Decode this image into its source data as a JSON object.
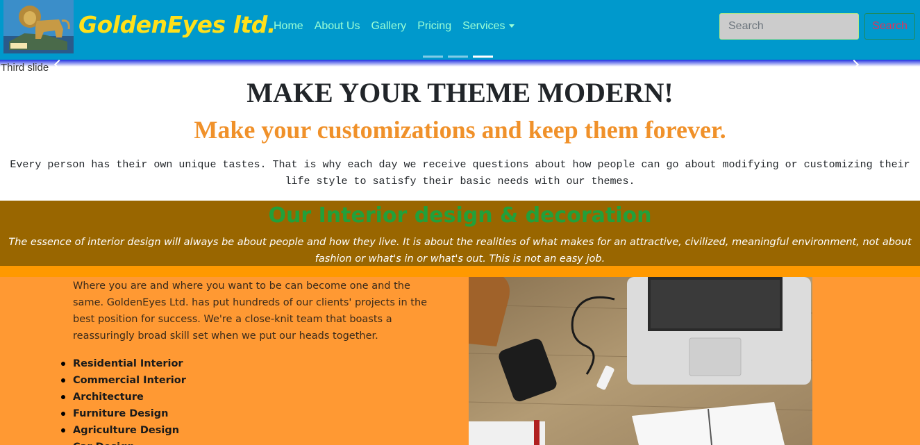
{
  "brand": {
    "name": "GoldenEyes ltd."
  },
  "nav": {
    "items": [
      {
        "label": "Home"
      },
      {
        "label": "About Us"
      },
      {
        "label": "Gallery"
      },
      {
        "label": "Pricing"
      },
      {
        "label": "Services"
      }
    ]
  },
  "search": {
    "placeholder": "Search",
    "button_label": "Search"
  },
  "carousel": {
    "slide_alt": "Third slide",
    "active_indicator": 3,
    "indicator_count": 3
  },
  "hero": {
    "title": "MAKE YOUR THEME MODERN!",
    "subtitle": "Make your customizations and keep them forever.",
    "body": "Every person has their own unique tastes. That is why each day we receive questions about how people can go about modifying or customizing their life style to satisfy their basic needs with our themes."
  },
  "interior": {
    "title": "Our Interior design & decoration",
    "quote": "The essence of interior design will always be about people and how they live. It is about the realities of what makes for an attractive, civilized, meaningful environment, not about fashion or what's in or what's out. This is not an easy job."
  },
  "about": {
    "text": "Where you are and where you want to be can become one and the same. GoldenEyes Ltd. has put hundreds of our clients' projects in the best position for success. We're a close-knit team that boasts a reassuringly broad skill set when we put our heads together.",
    "services": [
      {
        "label": "Residential Interior"
      },
      {
        "label": "Commercial Interior"
      },
      {
        "label": "Architecture"
      },
      {
        "label": "Furniture Design"
      },
      {
        "label": "Agriculture Design"
      },
      {
        "label": "Car Design"
      }
    ]
  },
  "colors": {
    "navbar": "#0099cc",
    "brand": "#ffe01a",
    "nav_link": "#9bffd6",
    "interior_band": "#996600",
    "interior_title": "#22a03a",
    "orange_section": "#ff9933",
    "hero_subtitle": "#f0912a"
  },
  "icons": {
    "logo": "lion-logo-icon",
    "services_caret": "caret-down-icon",
    "carousel_prev": "chevron-left-icon",
    "carousel_next": "chevron-right-icon"
  }
}
